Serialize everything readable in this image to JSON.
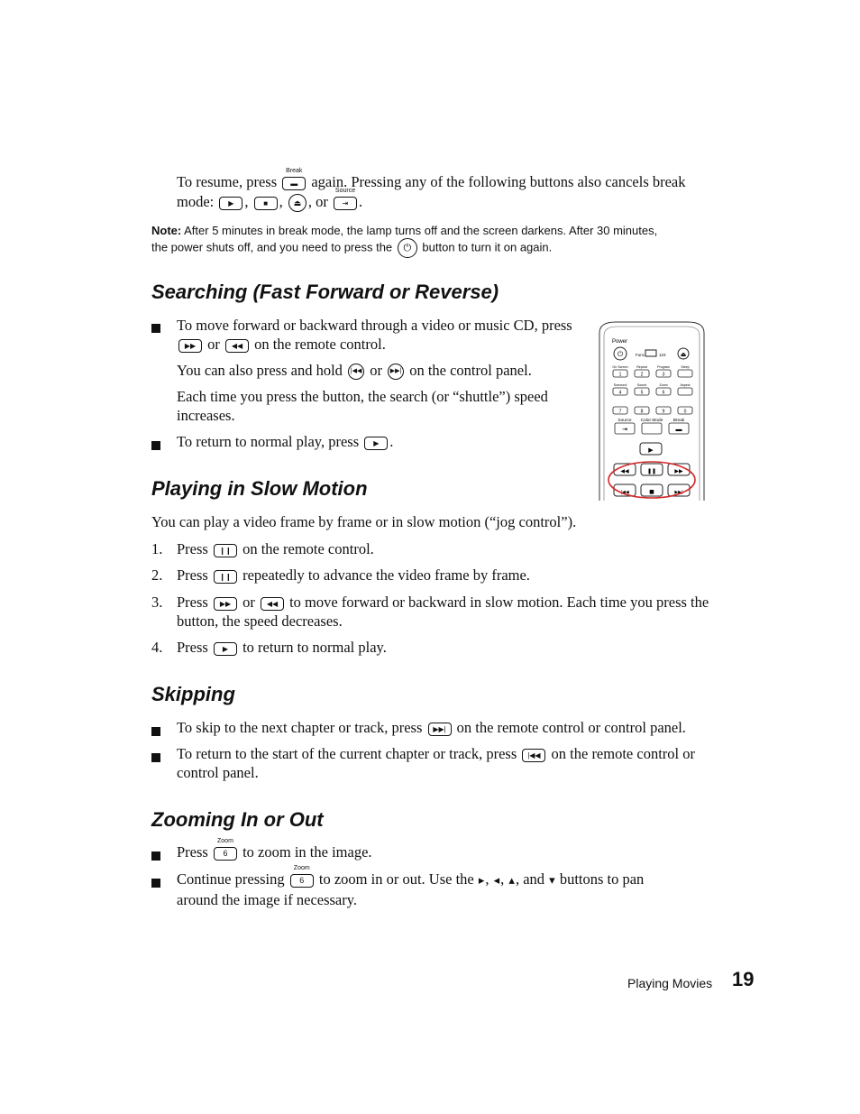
{
  "intro": {
    "resume_pre": "To resume, press",
    "break_label": "Break",
    "resume_post": "again. Pressing any of the following buttons also cancels break",
    "mode_pre": "mode:",
    "sep1": ",",
    "sep2": ",",
    "sep3": ", or",
    "source_label": "Source",
    "end": "."
  },
  "note": {
    "label": "Note:",
    "text1": "After 5 minutes in break mode, the lamp turns off and the screen darkens. After 30 minutes,",
    "text2_pre": "the power shuts off, and you need to press the",
    "text2_post": "button to turn it on again."
  },
  "searching": {
    "heading": "Searching (Fast Forward or Reverse)",
    "b1_line1": "To move forward or backward through a video or music CD, press",
    "b1_or": "or",
    "b1_line2_post": "on the remote control.",
    "p1_pre": "You can also press and hold",
    "p1_or": "or",
    "p1_post": "on the control panel.",
    "p2_line1": "Each time you press the button, the search (or “shuttle”) speed",
    "p2_line2": "increases.",
    "b2_pre": "To return to normal play, press",
    "b2_post": "."
  },
  "remote": {
    "power": "Power",
    "func": "Func",
    "num123": "123",
    "labels_row1": [
      "On Screen",
      "Repeat",
      "Program",
      "Sleep"
    ],
    "keys_row1": [
      "1",
      "2",
      "3",
      ""
    ],
    "labels_row2": [
      "Surround",
      "Sound",
      "Zoom",
      "Aspect"
    ],
    "keys_row2": [
      "4",
      "5",
      "6",
      ""
    ],
    "keys_row3": [
      "7",
      "8",
      "9",
      "0"
    ],
    "labels_row4": [
      "Source",
      "Color Mode",
      "Break"
    ]
  },
  "slow": {
    "heading": "Playing in Slow Motion",
    "intro": "You can play a video frame by frame or in slow motion (“jog control”).",
    "steps": [
      {
        "num": "1.",
        "pre": "Press",
        "post": "on the remote control."
      },
      {
        "num": "2.",
        "pre": "Press",
        "post": "repeatedly to advance the video frame by frame."
      },
      {
        "num": "3.",
        "pre": "Press",
        "or": "or",
        "post": "to move forward or backward in slow motion. Each time you press the",
        "line2": "button, the speed decreases."
      },
      {
        "num": "4.",
        "pre": "Press",
        "post": "to return to normal play."
      }
    ]
  },
  "skipping": {
    "heading": "Skipping",
    "b1_pre": "To skip to the next chapter or track, press",
    "b1_post": "on the remote control or control panel.",
    "b2_pre": "To return to the start of the current chapter or track, press",
    "b2_post": "on the remote control or",
    "b2_line2": "control panel."
  },
  "zooming": {
    "heading": "Zooming In or Out",
    "zoom_label": "Zoom",
    "zoom_key": "6",
    "b1_pre": "Press",
    "b1_post": "to zoom in the image.",
    "b2_pre": "Continue pressing",
    "b2_mid": "to zoom in or out. Use the",
    "c1": ",",
    "c2": ",",
    "c3": ", and",
    "b2_post": "buttons to pan",
    "b2_line2": "around the image if necessary."
  },
  "footer": {
    "section": "Playing Movies",
    "page": "19"
  },
  "icons": {
    "play": "▶",
    "stop": "■",
    "eject": "⏏",
    "source": "⇥",
    "break": "▬",
    "power": "⏻",
    "ff": "▶▶",
    "rew": "◀◀",
    "next": "▶▶|",
    "prev": "|◀◀",
    "pause": "❙❙",
    "right": "▸",
    "left": "◂",
    "up": "▴",
    "down": "▾"
  },
  "colors": {
    "highlight": "#d42a2a"
  }
}
